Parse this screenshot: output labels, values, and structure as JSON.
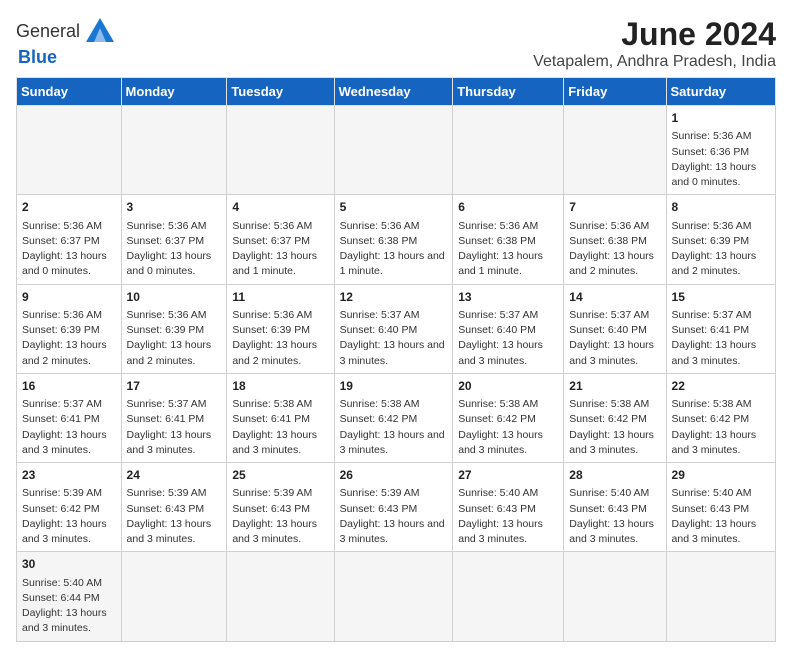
{
  "logo": {
    "line1": "General",
    "line2": "Blue"
  },
  "title": "June 2024",
  "subtitle": "Vetapalem, Andhra Pradesh, India",
  "weekdays": [
    "Sunday",
    "Monday",
    "Tuesday",
    "Wednesday",
    "Thursday",
    "Friday",
    "Saturday"
  ],
  "weeks": [
    [
      {
        "day": "",
        "info": ""
      },
      {
        "day": "",
        "info": ""
      },
      {
        "day": "",
        "info": ""
      },
      {
        "day": "",
        "info": ""
      },
      {
        "day": "",
        "info": ""
      },
      {
        "day": "",
        "info": ""
      },
      {
        "day": "1",
        "info": "Sunrise: 5:36 AM\nSunset: 6:36 PM\nDaylight: 13 hours and 0 minutes."
      }
    ],
    [
      {
        "day": "2",
        "info": "Sunrise: 5:36 AM\nSunset: 6:37 PM\nDaylight: 13 hours and 0 minutes."
      },
      {
        "day": "3",
        "info": "Sunrise: 5:36 AM\nSunset: 6:37 PM\nDaylight: 13 hours and 0 minutes."
      },
      {
        "day": "4",
        "info": "Sunrise: 5:36 AM\nSunset: 6:37 PM\nDaylight: 13 hours and 1 minute."
      },
      {
        "day": "5",
        "info": "Sunrise: 5:36 AM\nSunset: 6:38 PM\nDaylight: 13 hours and 1 minute."
      },
      {
        "day": "6",
        "info": "Sunrise: 5:36 AM\nSunset: 6:38 PM\nDaylight: 13 hours and 1 minute."
      },
      {
        "day": "7",
        "info": "Sunrise: 5:36 AM\nSunset: 6:38 PM\nDaylight: 13 hours and 2 minutes."
      },
      {
        "day": "8",
        "info": "Sunrise: 5:36 AM\nSunset: 6:39 PM\nDaylight: 13 hours and 2 minutes."
      }
    ],
    [
      {
        "day": "9",
        "info": "Sunrise: 5:36 AM\nSunset: 6:39 PM\nDaylight: 13 hours and 2 minutes."
      },
      {
        "day": "10",
        "info": "Sunrise: 5:36 AM\nSunset: 6:39 PM\nDaylight: 13 hours and 2 minutes."
      },
      {
        "day": "11",
        "info": "Sunrise: 5:36 AM\nSunset: 6:39 PM\nDaylight: 13 hours and 2 minutes."
      },
      {
        "day": "12",
        "info": "Sunrise: 5:37 AM\nSunset: 6:40 PM\nDaylight: 13 hours and 3 minutes."
      },
      {
        "day": "13",
        "info": "Sunrise: 5:37 AM\nSunset: 6:40 PM\nDaylight: 13 hours and 3 minutes."
      },
      {
        "day": "14",
        "info": "Sunrise: 5:37 AM\nSunset: 6:40 PM\nDaylight: 13 hours and 3 minutes."
      },
      {
        "day": "15",
        "info": "Sunrise: 5:37 AM\nSunset: 6:41 PM\nDaylight: 13 hours and 3 minutes."
      }
    ],
    [
      {
        "day": "16",
        "info": "Sunrise: 5:37 AM\nSunset: 6:41 PM\nDaylight: 13 hours and 3 minutes."
      },
      {
        "day": "17",
        "info": "Sunrise: 5:37 AM\nSunset: 6:41 PM\nDaylight: 13 hours and 3 minutes."
      },
      {
        "day": "18",
        "info": "Sunrise: 5:38 AM\nSunset: 6:41 PM\nDaylight: 13 hours and 3 minutes."
      },
      {
        "day": "19",
        "info": "Sunrise: 5:38 AM\nSunset: 6:42 PM\nDaylight: 13 hours and 3 minutes."
      },
      {
        "day": "20",
        "info": "Sunrise: 5:38 AM\nSunset: 6:42 PM\nDaylight: 13 hours and 3 minutes."
      },
      {
        "day": "21",
        "info": "Sunrise: 5:38 AM\nSunset: 6:42 PM\nDaylight: 13 hours and 3 minutes."
      },
      {
        "day": "22",
        "info": "Sunrise: 5:38 AM\nSunset: 6:42 PM\nDaylight: 13 hours and 3 minutes."
      }
    ],
    [
      {
        "day": "23",
        "info": "Sunrise: 5:39 AM\nSunset: 6:42 PM\nDaylight: 13 hours and 3 minutes."
      },
      {
        "day": "24",
        "info": "Sunrise: 5:39 AM\nSunset: 6:43 PM\nDaylight: 13 hours and 3 minutes."
      },
      {
        "day": "25",
        "info": "Sunrise: 5:39 AM\nSunset: 6:43 PM\nDaylight: 13 hours and 3 minutes."
      },
      {
        "day": "26",
        "info": "Sunrise: 5:39 AM\nSunset: 6:43 PM\nDaylight: 13 hours and 3 minutes."
      },
      {
        "day": "27",
        "info": "Sunrise: 5:40 AM\nSunset: 6:43 PM\nDaylight: 13 hours and 3 minutes."
      },
      {
        "day": "28",
        "info": "Sunrise: 5:40 AM\nSunset: 6:43 PM\nDaylight: 13 hours and 3 minutes."
      },
      {
        "day": "29",
        "info": "Sunrise: 5:40 AM\nSunset: 6:43 PM\nDaylight: 13 hours and 3 minutes."
      }
    ],
    [
      {
        "day": "30",
        "info": "Sunrise: 5:40 AM\nSunset: 6:44 PM\nDaylight: 13 hours and 3 minutes."
      },
      {
        "day": "",
        "info": ""
      },
      {
        "day": "",
        "info": ""
      },
      {
        "day": "",
        "info": ""
      },
      {
        "day": "",
        "info": ""
      },
      {
        "day": "",
        "info": ""
      },
      {
        "day": "",
        "info": ""
      }
    ]
  ]
}
